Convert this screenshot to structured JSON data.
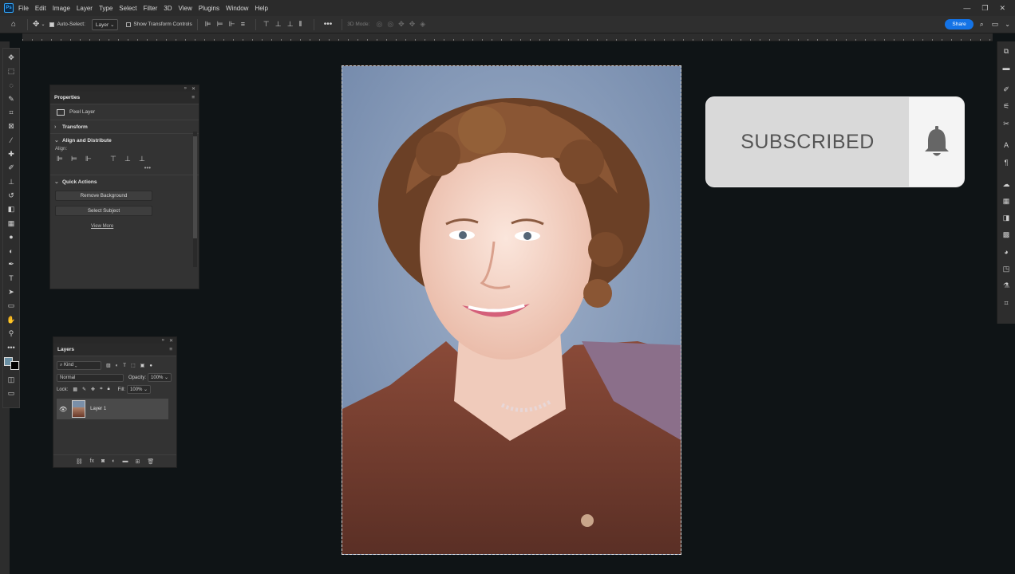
{
  "menu": {
    "items": [
      "File",
      "Edit",
      "Image",
      "Layer",
      "Type",
      "Select",
      "Filter",
      "3D",
      "View",
      "Plugins",
      "Window",
      "Help"
    ]
  },
  "options_bar": {
    "auto_select_label": "Auto-Select:",
    "auto_select_value": "Layer",
    "show_transform_label": "Show Transform Controls",
    "mode_3d_label": "3D Mode:",
    "share_label": "Share"
  },
  "properties": {
    "tab_label": "Properties",
    "pixel_layer_label": "Pixel Layer",
    "transform_label": "Transform",
    "align_distribute_label": "Align and Distribute",
    "align_label": "Align:",
    "quick_actions_label": "Quick Actions",
    "remove_bg_label": "Remove Background",
    "select_subject_label": "Select Subject",
    "view_more_label": "View More"
  },
  "layers": {
    "tab_label": "Layers",
    "kind_label": "Kind",
    "blend_mode": "Normal",
    "opacity_label": "Opacity:",
    "opacity_value": "100%",
    "lock_label": "Lock:",
    "fill_label": "Fill:",
    "fill_value": "100%",
    "layer_name": "Layer 1"
  },
  "overlay": {
    "subscribed_label": "SUBSCRIBED"
  },
  "colors": {
    "accent": "#1473e6",
    "app_bg": "#0f1416",
    "panel_bg": "#333333"
  },
  "icons": {
    "bell": "bell-icon",
    "eye": "eye-icon",
    "move": "move-tool-icon"
  }
}
